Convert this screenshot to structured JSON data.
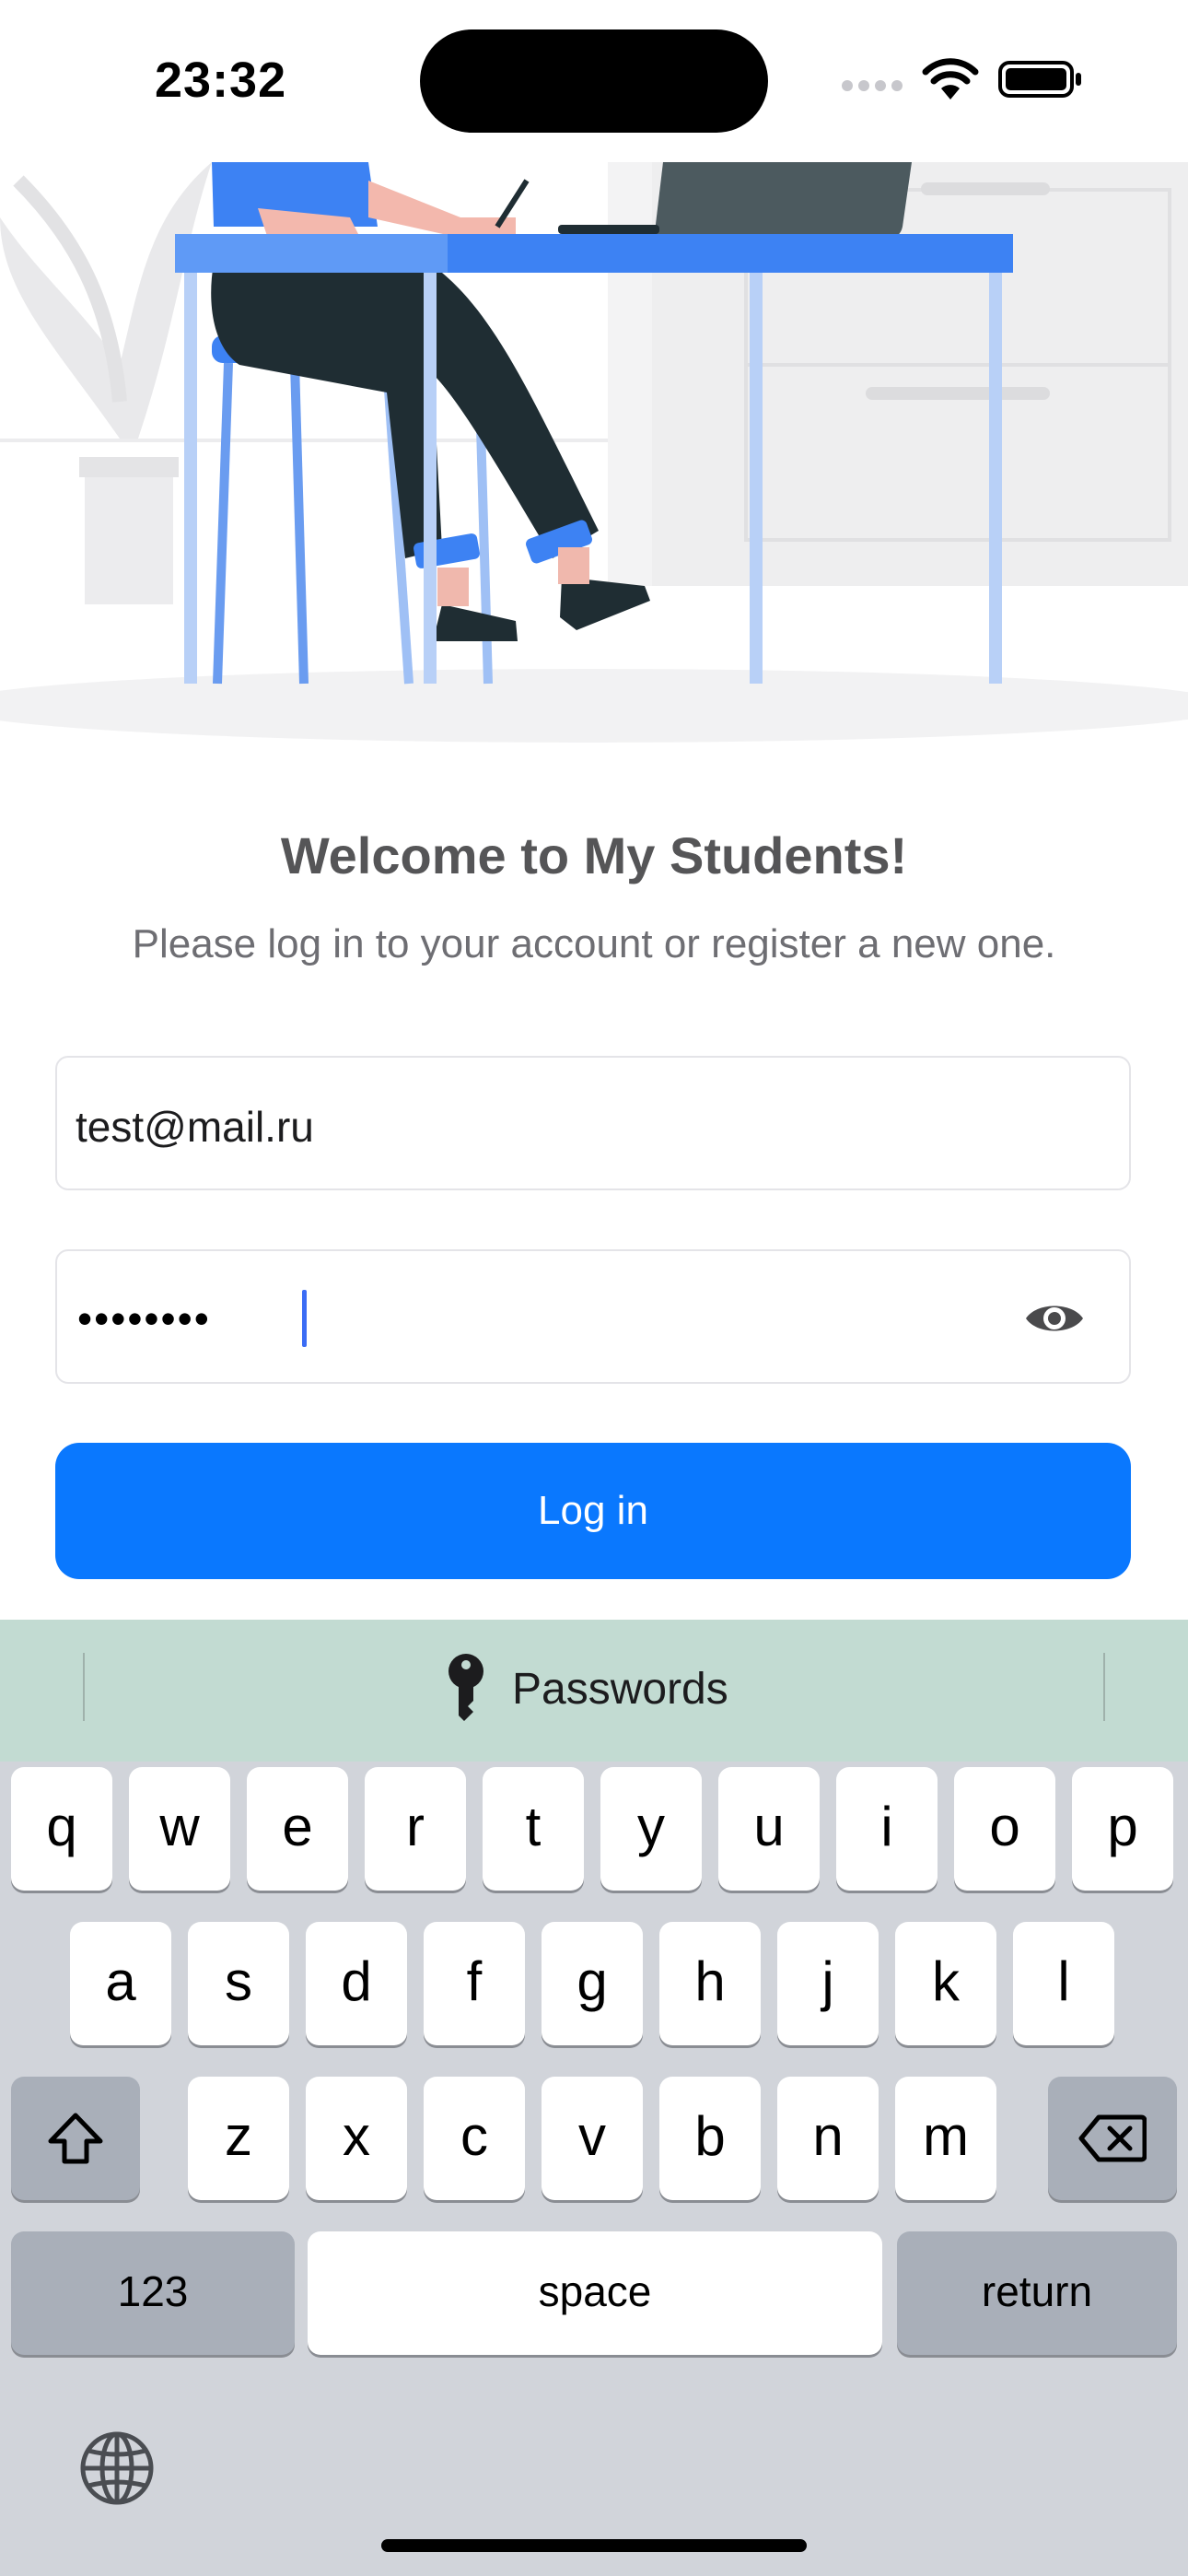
{
  "status_bar": {
    "time": "23:32"
  },
  "welcome": {
    "title": "Welcome to My Students!",
    "subtitle": "Please log in to your account or register a new one."
  },
  "form": {
    "email_value": "test@mail.ru",
    "password_mask": "••••••••",
    "login_label": "Log in"
  },
  "keyboard": {
    "suggestion": "Passwords",
    "row1": [
      "q",
      "w",
      "e",
      "r",
      "t",
      "y",
      "u",
      "i",
      "o",
      "p"
    ],
    "row2": [
      "a",
      "s",
      "d",
      "f",
      "g",
      "h",
      "j",
      "k",
      "l"
    ],
    "row3": [
      "z",
      "x",
      "c",
      "v",
      "b",
      "n",
      "m"
    ],
    "numbers_label": "123",
    "space_label": "space",
    "return_label": "return"
  },
  "colors": {
    "accent": "#0a78fe",
    "keyboard_bg": "#d1d4da",
    "suggestion_bg": "#c2dbd2"
  }
}
